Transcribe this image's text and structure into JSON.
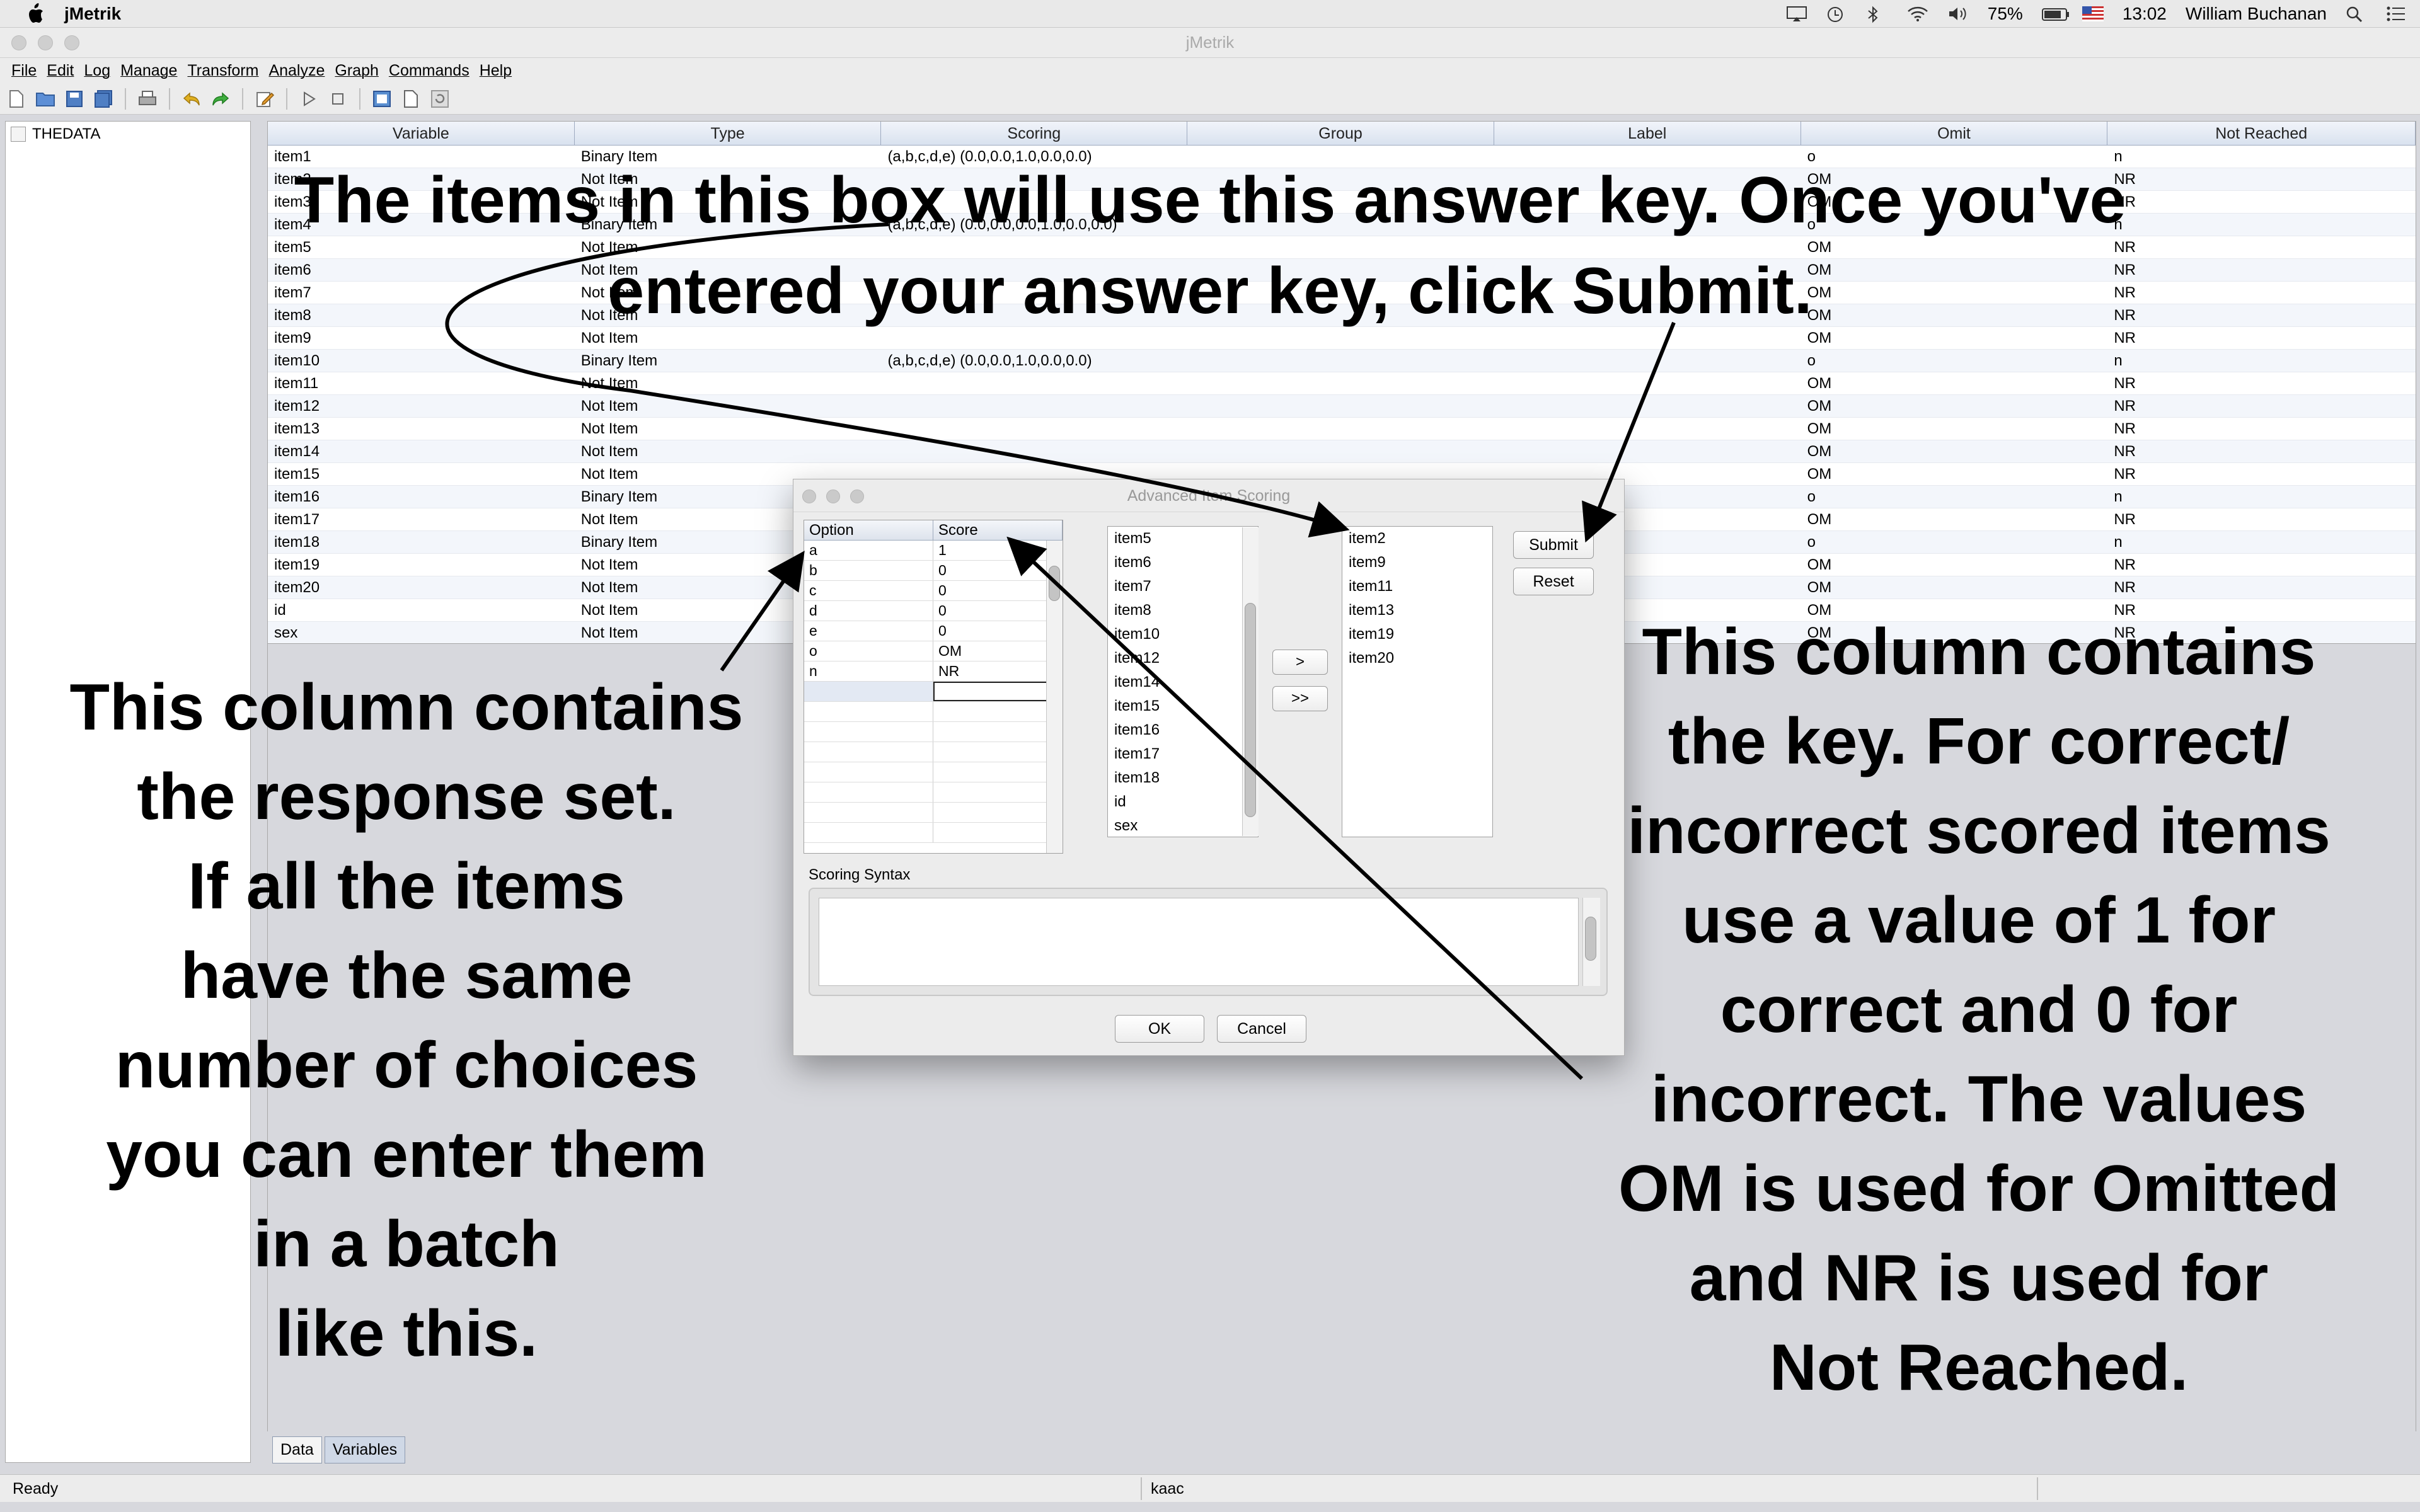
{
  "os_menubar": {
    "app_name": "jMetrik",
    "battery": "75%",
    "time": "13:02",
    "user": "William Buchanan"
  },
  "window": {
    "title": "jMetrik"
  },
  "menu": [
    "File",
    "Edit",
    "Log",
    "Manage",
    "Transform",
    "Analyze",
    "Graph",
    "Commands",
    "Help"
  ],
  "sidebar": {
    "node_label": "THEDATA"
  },
  "table": {
    "headers": [
      "Variable",
      "Type",
      "Scoring",
      "Group",
      "Label",
      "Omit",
      "Not Reached"
    ],
    "rows": [
      [
        "item1",
        "Binary Item",
        "(a,b,c,d,e) (0.0,0.0,1.0,0.0,0.0)",
        "",
        "",
        "o",
        "n"
      ],
      [
        "item2",
        "Not Item",
        "",
        "",
        "",
        "OM",
        "NR"
      ],
      [
        "item3",
        "Not Item",
        "",
        "",
        "",
        "OM",
        "NR"
      ],
      [
        "item4",
        "Binary Item",
        "(a,b,c,d,e) (0.0,0.0,0.0,1.0,0.0,0.0)",
        "",
        "",
        "o",
        "n"
      ],
      [
        "item5",
        "Not Item",
        "",
        "",
        "",
        "OM",
        "NR"
      ],
      [
        "item6",
        "Not Item",
        "",
        "",
        "",
        "OM",
        "NR"
      ],
      [
        "item7",
        "Not Item",
        "",
        "",
        "",
        "OM",
        "NR"
      ],
      [
        "item8",
        "Not Item",
        "",
        "",
        "",
        "OM",
        "NR"
      ],
      [
        "item9",
        "Not Item",
        "",
        "",
        "",
        "OM",
        "NR"
      ],
      [
        "item10",
        "Binary Item",
        "(a,b,c,d,e) (0.0,0.0,1.0,0.0,0.0)",
        "",
        "",
        "o",
        "n"
      ],
      [
        "item11",
        "Not Item",
        "",
        "",
        "",
        "OM",
        "NR"
      ],
      [
        "item12",
        "Not Item",
        "",
        "",
        "",
        "OM",
        "NR"
      ],
      [
        "item13",
        "Not Item",
        "",
        "",
        "",
        "OM",
        "NR"
      ],
      [
        "item14",
        "Not Item",
        "",
        "",
        "",
        "OM",
        "NR"
      ],
      [
        "item15",
        "Not Item",
        "",
        "",
        "",
        "OM",
        "NR"
      ],
      [
        "item16",
        "Binary Item",
        "",
        "",
        "",
        "o",
        "n"
      ],
      [
        "item17",
        "Not Item",
        "",
        "",
        "",
        "OM",
        "NR"
      ],
      [
        "item18",
        "Binary Item",
        "",
        "",
        "",
        "o",
        "n"
      ],
      [
        "item19",
        "Not Item",
        "",
        "",
        "",
        "OM",
        "NR"
      ],
      [
        "item20",
        "Not Item",
        "",
        "",
        "",
        "OM",
        "NR"
      ],
      [
        "id",
        "Not Item",
        "",
        "",
        "",
        "OM",
        "NR"
      ],
      [
        "sex",
        "Not Item",
        "",
        "",
        "",
        "OM",
        "NR"
      ]
    ]
  },
  "tabs": [
    "Data",
    "Variables"
  ],
  "status": {
    "left": "Ready",
    "middle": "kaac"
  },
  "dialog": {
    "title": "Advanced Item Scoring",
    "option_header": "Option",
    "score_header": "Score",
    "options": [
      [
        "a",
        "1"
      ],
      [
        "b",
        "0"
      ],
      [
        "c",
        "0"
      ],
      [
        "d",
        "0"
      ],
      [
        "e",
        "0"
      ],
      [
        "o",
        "OM"
      ],
      [
        "n",
        "NR"
      ]
    ],
    "available_items": [
      "item5",
      "item6",
      "item7",
      "item8",
      "item10",
      "item12",
      "item14",
      "item15",
      "item16",
      "item17",
      "item18",
      "id",
      "sex"
    ],
    "selected_items": [
      "item2",
      "item9",
      "item11",
      "item13",
      "item19",
      "item20"
    ],
    "move_one_label": ">",
    "move_all_label": ">>",
    "submit_label": "Submit",
    "reset_label": "Reset",
    "syntax_label": "Scoring Syntax",
    "ok_label": "OK",
    "cancel_label": "Cancel"
  },
  "annotations": {
    "top": [
      "The items in this box will use this answer key. Once you've",
      "entered your answer key, click Submit."
    ],
    "left": [
      "This column contains",
      "the response set.",
      "If all the items",
      "have the same",
      "number of choices",
      "you can enter them",
      "in a batch",
      "like this."
    ],
    "right": [
      "This column contains",
      "the key.  For correct/",
      "incorrect scored items",
      "use a value of 1 for",
      "correct and 0 for",
      "incorrect.  The values",
      "OM is used for Omitted",
      "and NR is used for",
      "Not Reached."
    ]
  }
}
